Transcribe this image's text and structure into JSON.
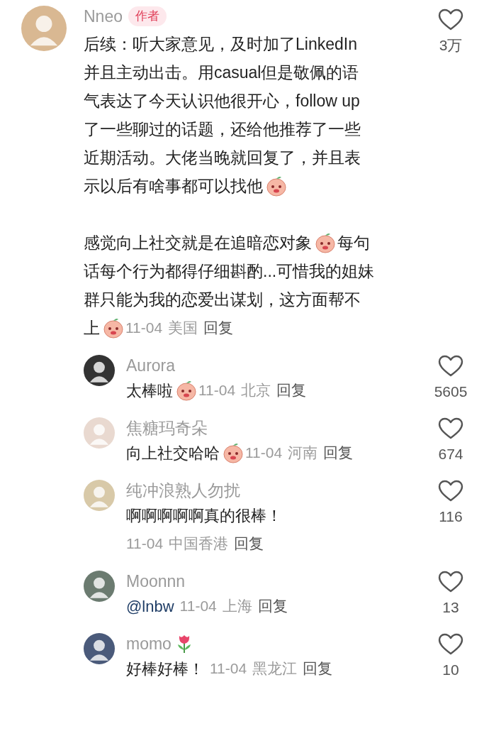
{
  "comment": {
    "author": "Nneo",
    "badge": "作者",
    "likes": "3万",
    "paragraphs": [
      [
        [
          {
            "kind": "text",
            "text": "后续：听大家意见，及时加了LinkedIn"
          }
        ],
        [
          {
            "kind": "text",
            "text": "并且主动出击。用casual但是敬佩的语"
          }
        ],
        [
          {
            "kind": "text",
            "text": "气表达了今天认识他很开心，follow up"
          }
        ],
        [
          {
            "kind": "text",
            "text": "了一些聊过的话题，还给他推荐了一些"
          }
        ],
        [
          {
            "kind": "text",
            "text": "近期活动。大佬当晚就回复了，并且表"
          }
        ],
        [
          {
            "kind": "text",
            "text": "示以后有啥事都可以找他"
          },
          {
            "kind": "sticker"
          }
        ]
      ],
      [
        [
          {
            "kind": "text",
            "text": "感觉向上社交就是在追暗恋对象"
          },
          {
            "kind": "sticker"
          },
          {
            "kind": "text",
            "text": "每句"
          }
        ],
        [
          {
            "kind": "text",
            "text": "话每个行为都得仔细斟酌...可惜我的姐妹"
          }
        ],
        [
          {
            "kind": "text",
            "text": "群只能为我的恋爱出谋划，这方面帮不"
          }
        ],
        [
          {
            "kind": "text",
            "text": "上"
          },
          {
            "kind": "sticker"
          },
          {
            "kind": "date",
            "text": "11-04"
          },
          {
            "kind": "location",
            "text": "美国"
          },
          {
            "kind": "reply",
            "text": "回复"
          }
        ]
      ]
    ]
  },
  "replies": [
    {
      "author": "Aurora",
      "likes": "5605",
      "lines": [
        [
          {
            "kind": "text",
            "text": "太棒啦"
          },
          {
            "kind": "sticker"
          },
          {
            "kind": "date",
            "text": "11-04"
          },
          {
            "kind": "location",
            "text": "北京"
          },
          {
            "kind": "reply",
            "text": "回复"
          }
        ]
      ]
    },
    {
      "author": "焦糖玛奇朵",
      "likes": "674",
      "lines": [
        [
          {
            "kind": "text",
            "text": "向上社交哈哈"
          },
          {
            "kind": "sticker"
          },
          {
            "kind": "date",
            "text": "11-04"
          },
          {
            "kind": "location",
            "text": "河南"
          },
          {
            "kind": "reply",
            "text": "回复"
          }
        ]
      ]
    },
    {
      "author": "纯冲浪熟人勿扰",
      "likes": "116",
      "lines": [
        [
          {
            "kind": "text",
            "text": "啊啊啊啊啊真的很棒！"
          }
        ],
        [
          {
            "kind": "date",
            "text": "11-04"
          },
          {
            "kind": "location",
            "text": "中国香港"
          },
          {
            "kind": "reply",
            "text": "回复"
          }
        ]
      ]
    },
    {
      "author": "Moonnn",
      "likes": "13",
      "lines": [
        [
          {
            "kind": "mention",
            "text": "@lnbw"
          },
          {
            "kind": "date",
            "text": "11-04"
          },
          {
            "kind": "location",
            "text": "上海"
          },
          {
            "kind": "reply",
            "text": "回复"
          }
        ]
      ]
    },
    {
      "author": "momo",
      "author_flower": true,
      "likes": "10",
      "lines": [
        [
          {
            "kind": "text",
            "text": "好棒好棒！"
          },
          {
            "kind": "date",
            "text": "11-04"
          },
          {
            "kind": "location",
            "text": "黑龙江"
          },
          {
            "kind": "reply",
            "text": "回复"
          }
        ]
      ]
    }
  ]
}
